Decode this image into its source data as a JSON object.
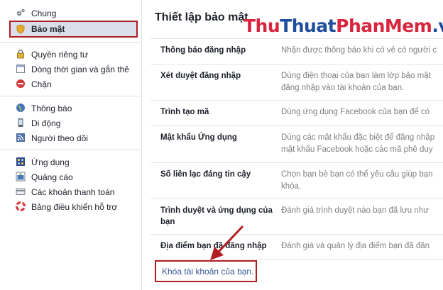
{
  "sidebar": {
    "group1": [
      {
        "label": "Chung",
        "icon": "gears-icon"
      },
      {
        "label": "Bảo mật",
        "icon": "security-badge-icon",
        "selected": true
      }
    ],
    "group2": [
      {
        "label": "Quyền riêng tư",
        "icon": "lock-icon"
      },
      {
        "label": "Dòng thời gian và gắn thẻ",
        "icon": "timeline-icon"
      },
      {
        "label": "Chặn",
        "icon": "block-icon"
      }
    ],
    "group3": [
      {
        "label": "Thông báo",
        "icon": "globe-icon"
      },
      {
        "label": "Di động",
        "icon": "mobile-icon"
      },
      {
        "label": "Người theo dõi",
        "icon": "rss-icon"
      }
    ],
    "group4": [
      {
        "label": "Ứng dụng",
        "icon": "apps-icon"
      },
      {
        "label": "Quảng cáo",
        "icon": "ads-icon"
      },
      {
        "label": "Các khoản thanh toán",
        "icon": "credit-card-icon"
      },
      {
        "label": "Bảng điều khiển hỗ trợ",
        "icon": "lifebuoy-icon"
      }
    ]
  },
  "main": {
    "title": "Thiết lập bảo mật",
    "watermark": {
      "part1": "Thu",
      "part2": "Thuat",
      "part3": "PhanMem",
      "part4": ".vn"
    },
    "rows": [
      {
        "label": "Thông báo đăng nhập",
        "desc": [
          "Nhận được thông báo khi có vẻ có người c"
        ]
      },
      {
        "label": "Xét duyệt đăng nhập",
        "desc": [
          "Dùng điện thoại của bạn làm lớp bảo mật",
          "đăng nhập vào tài khoản của bạn."
        ]
      },
      {
        "label": "Trình tạo mã",
        "desc": [
          "Dùng ứng dụng Facebook của bạn để có"
        ]
      },
      {
        "label": "Mật khẩu Ứng dụng",
        "desc": [
          "Dùng các mật khẩu đặc biệt để đăng nhập",
          "mật khẩu Facebook hoặc các mã phê duy"
        ]
      },
      {
        "label": "Số liên lạc đáng tin cậy",
        "desc": [
          "Chọn bạn bè bạn có thể yêu cầu giúp bạn",
          "khóa."
        ]
      },
      {
        "label": "Trình duyệt và ứng dụng của bạn",
        "desc": [
          "Đánh giá trình duyệt nào bạn đã lưu như"
        ]
      },
      {
        "label": "Địa điểm bạn đã đăng nhập",
        "desc": [
          "Đánh giá và quản lý địa điểm bạn đã đăn"
        ]
      }
    ],
    "lock_link": "Khóa tài khoản của bạn."
  },
  "colors": {
    "highlight_border": "#b01e23",
    "link": "#3b5998",
    "selected_bg": "#d9dee8"
  }
}
